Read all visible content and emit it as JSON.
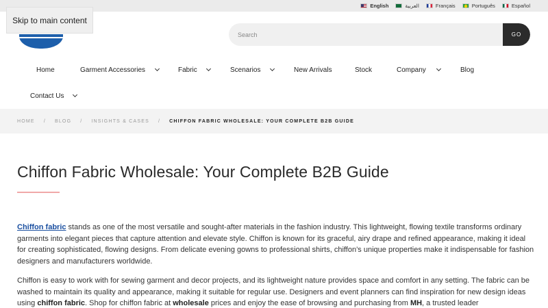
{
  "languages": [
    {
      "label": "English",
      "flag": "us-flag-icon",
      "active": true
    },
    {
      "label": "العربية",
      "flag": "saudi-flag-icon",
      "active": false
    },
    {
      "label": "Français",
      "flag": "french-flag-icon",
      "active": false
    },
    {
      "label": "Português",
      "flag": "brazil-flag-icon",
      "active": false
    },
    {
      "label": "Español",
      "flag": "mexico-flag-icon",
      "active": false
    }
  ],
  "skip_link": "Skip to main content",
  "search": {
    "placeholder": "Search",
    "button": "GO"
  },
  "nav": {
    "home": "Home",
    "garment_accessories": "Garment Accessories",
    "fabric": "Fabric",
    "scenarios": "Scenarios",
    "new_arrivals": "New Arrivals",
    "stock": "Stock",
    "company": "Company",
    "blog": "Blog",
    "contact_us": "Contact Us"
  },
  "breadcrumb": [
    "HOME",
    "BLOG",
    "INSIGHTS & CASES",
    "CHIFFON FABRIC WHOLESALE: YOUR COMPLETE B2B GUIDE"
  ],
  "article": {
    "title": "Chiffon Fabric Wholesale: Your Complete B2B Guide",
    "p1_link": "Chiffon fabric",
    "p1_text": " stands as one of the most versatile and sought-after materials in the fashion industry. This lightweight, flowing textile transforms ordinary garments into elegant pieces that capture attention and elevate style. Chiffon is known for its graceful, airy drape and refined appearance, making it ideal for creating sophisticated, flowing designs. From delicate evening gowns to professional shirts, chiffon’s unique properties make it indispensable for fashion designers and manufacturers worldwide.",
    "p2_a": "Chiffon is easy to work with for sewing garment and decor projects, and its lightweight nature provides space and comfort in any setting. The fabric can be washed to maintain its quality and appearance, making it suitable for regular use. Designers and event planners can find inspiration for new design ideas using ",
    "p2_b1": "chiffon fabric",
    "p2_c": ". Shop for chiffon fabric at ",
    "p2_b2": "wholesale",
    "p2_d": " prices and enjoy the ease of browsing and purchasing from ",
    "p2_b3": "MH",
    "p2_e": ", a trusted leader"
  },
  "colors": {
    "accent_underline": "#f0a8a8",
    "link": "#1a4fa0",
    "go_button": "#2b2b2b"
  }
}
